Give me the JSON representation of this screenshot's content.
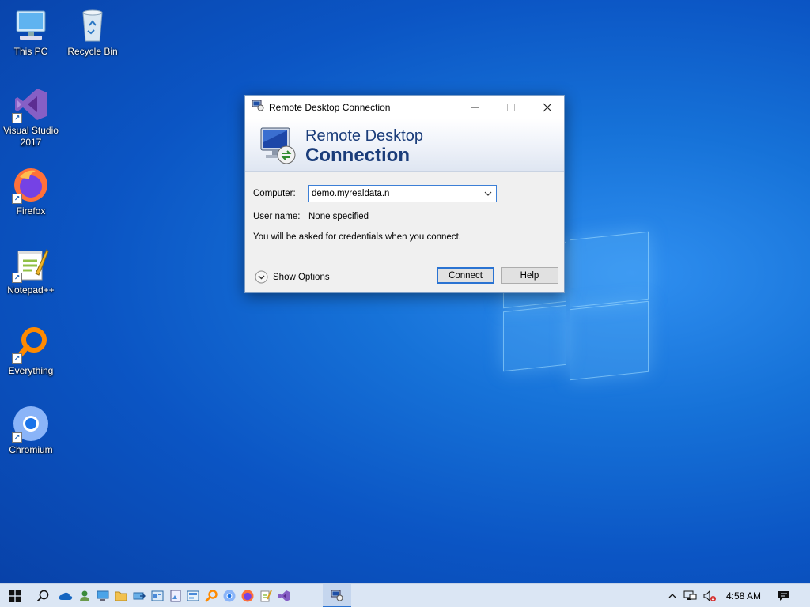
{
  "desktop": {
    "icons": [
      {
        "label": "This PC"
      },
      {
        "label": "Recycle Bin"
      },
      {
        "label": "Visual Studio 2017"
      },
      {
        "label": "Firefox"
      },
      {
        "label": "Notepad++"
      },
      {
        "label": "Everything"
      },
      {
        "label": "Chromium"
      }
    ]
  },
  "dialog": {
    "title": "Remote Desktop Connection",
    "banner_line1": "Remote Desktop",
    "banner_line2": "Connection",
    "computer_label": "Computer:",
    "computer_value": "demo.myrealdata.n",
    "username_label": "User name:",
    "username_value": "None specified",
    "info_text": "You will be asked for credentials when you connect.",
    "show_options": "Show Options",
    "connect": "Connect",
    "help": "Help"
  },
  "taskbar": {
    "time": "4:58 AM"
  },
  "colors": {
    "accent": "#2a73d2",
    "banner_text": "#1b3d7a"
  }
}
